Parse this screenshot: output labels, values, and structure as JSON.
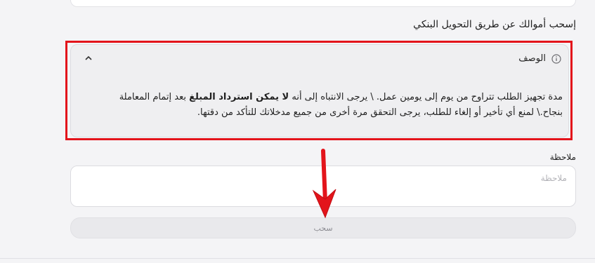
{
  "section": {
    "title": "إسحب أموالك عن طريق التحويل البنكي"
  },
  "description": {
    "heading": "الوصف",
    "info_icon": "info-circle-icon",
    "chevron_icon": "chevron-up-icon",
    "text_part1": "مدة تجهيز الطلب تتراوح من يوم إلى يومين عمل. \\ يرجى الانتباه إلى أنه ",
    "text_bold": "لا يمكن استرداد المبلغ",
    "text_part2": " بعد إتمام المعاملة بنجاح.\\ لمنع أي تأخير أو إلغاء للطلب، يرجى التحقق مرة أخرى من جميع مدخلاتك للتأكد من دقتها."
  },
  "note": {
    "label": "ملاحظة",
    "placeholder": "ملاحظة",
    "value": ""
  },
  "withdraw_button": {
    "label": "سحب"
  },
  "annotation": {
    "highlight_color": "#e3141b",
    "arrow_color": "#e3141b"
  }
}
